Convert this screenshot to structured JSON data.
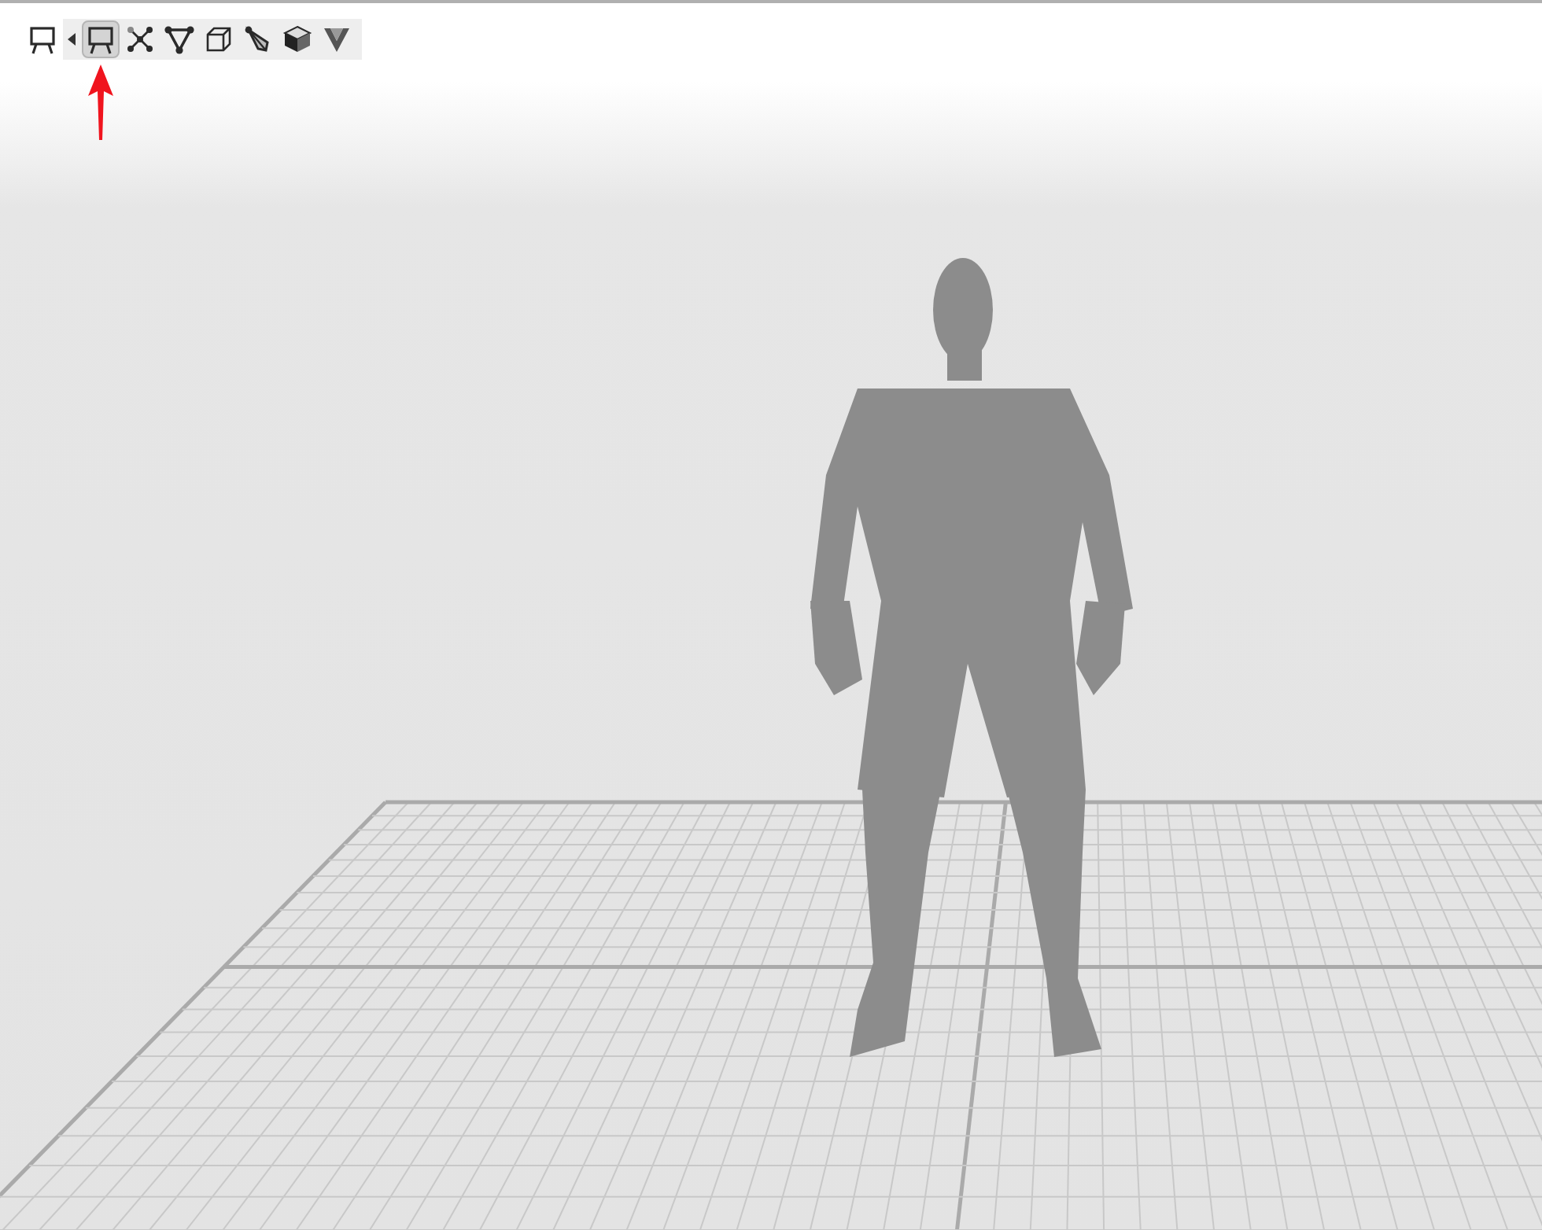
{
  "toolbar": {
    "current_mode": {
      "kind": "easel"
    },
    "buttons": [
      {
        "kind": "easel",
        "selected": true,
        "pointed": true
      },
      {
        "kind": "nodes",
        "selected": false,
        "pointed": false
      },
      {
        "kind": "triangle",
        "selected": false,
        "pointed": false
      },
      {
        "kind": "wire-cube",
        "selected": false,
        "pointed": false
      },
      {
        "kind": "kite",
        "selected": false,
        "pointed": false
      },
      {
        "kind": "solid-cube",
        "selected": false,
        "pointed": false
      },
      {
        "kind": "v-shape",
        "selected": false,
        "pointed": false
      }
    ]
  }
}
